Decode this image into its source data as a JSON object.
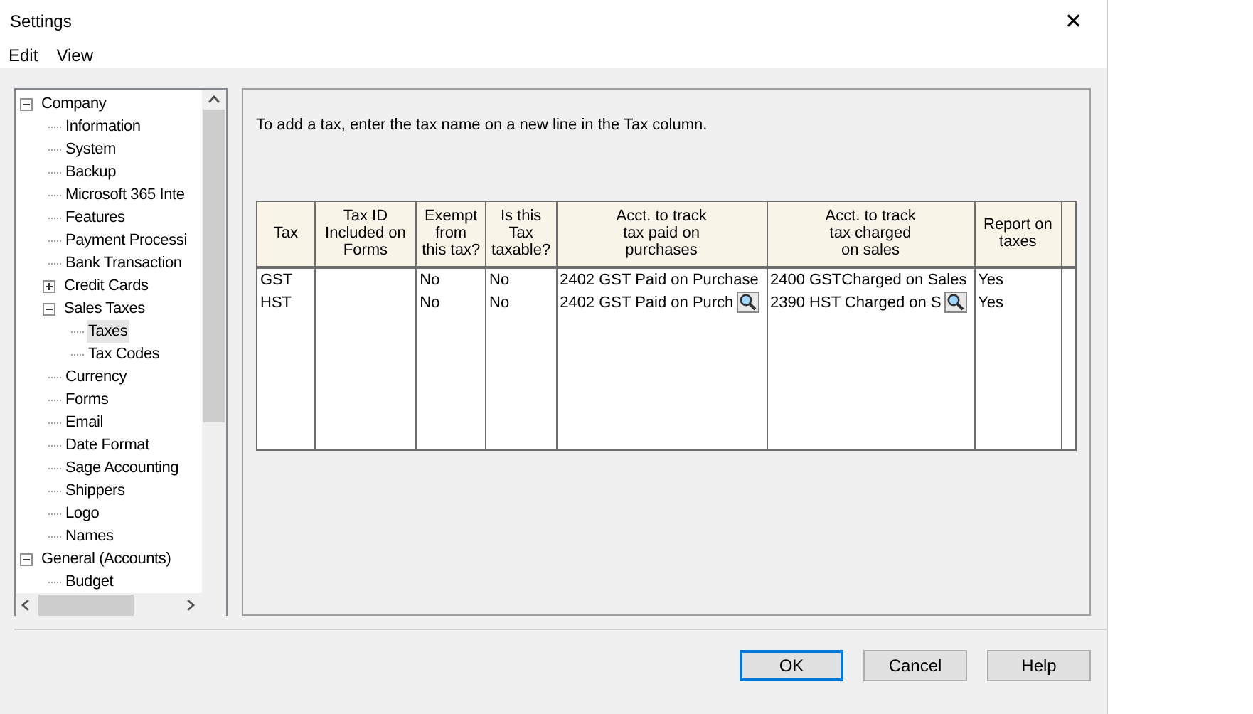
{
  "window": {
    "title": "Settings",
    "close": "✕"
  },
  "menu": [
    "Edit",
    "View"
  ],
  "tree": [
    {
      "label": "Company",
      "expanded": true,
      "selected": false,
      "children": [
        {
          "label": "Information",
          "selected": false
        },
        {
          "label": "System",
          "selected": false
        },
        {
          "label": "Backup",
          "selected": false
        },
        {
          "label": "Microsoft 365 Inte",
          "selected": false
        },
        {
          "label": "Features",
          "selected": false
        },
        {
          "label": "Payment Processi",
          "selected": false
        },
        {
          "label": "Bank Transaction",
          "selected": false
        },
        {
          "label": "Credit Cards",
          "expanded": false,
          "selected": false
        },
        {
          "label": "Sales Taxes",
          "expanded": true,
          "selected": false,
          "children": [
            {
              "label": "Taxes",
              "selected": true
            },
            {
              "label": "Tax Codes",
              "selected": false
            }
          ]
        },
        {
          "label": "Currency",
          "selected": false
        },
        {
          "label": "Forms",
          "selected": false
        },
        {
          "label": "Email",
          "selected": false
        },
        {
          "label": "Date Format",
          "selected": false
        },
        {
          "label": "Sage Accounting",
          "selected": false
        },
        {
          "label": "Shippers",
          "selected": false
        },
        {
          "label": "Logo",
          "selected": false
        },
        {
          "label": "Names",
          "selected": false
        }
      ]
    },
    {
      "label": "General (Accounts)",
      "expanded": true,
      "selected": false,
      "children": [
        {
          "label": "Budget",
          "selected": false
        }
      ]
    }
  ],
  "instructions": "To add a tax, enter the tax name on a new line in the Tax column.",
  "table": {
    "columns": [
      "Tax",
      "Tax ID\nIncluded on\nForms",
      "Exempt\nfrom\nthis tax?",
      "Is this\nTax\ntaxable?",
      "Acct. to track\ntax paid on\npurchases",
      "Acct. to track\ntax charged\non sales",
      "Report on\ntaxes"
    ],
    "rows": [
      {
        "cells": [
          {
            "text": "GST",
            "lookup": false
          },
          {
            "text": "",
            "lookup": false
          },
          {
            "text": "No",
            "lookup": false
          },
          {
            "text": "No",
            "lookup": false
          },
          {
            "text": "2402 GST Paid on Purchase",
            "lookup": false
          },
          {
            "text": "2400 GSTCharged on Sales",
            "lookup": false
          },
          {
            "text": "Yes",
            "lookup": false
          }
        ]
      },
      {
        "cells": [
          {
            "text": "HST",
            "lookup": false
          },
          {
            "text": "",
            "lookup": false
          },
          {
            "text": "No",
            "lookup": false
          },
          {
            "text": "No",
            "lookup": false
          },
          {
            "text": "2402 GST Paid on Purch",
            "lookup": true
          },
          {
            "text": "2390 HST Charged on S",
            "lookup": true
          },
          {
            "text": "Yes",
            "lookup": false
          }
        ]
      }
    ]
  },
  "buttons": [
    {
      "label": "OK",
      "default": true
    },
    {
      "label": "Cancel",
      "default": false
    },
    {
      "label": "Help",
      "default": false
    }
  ]
}
